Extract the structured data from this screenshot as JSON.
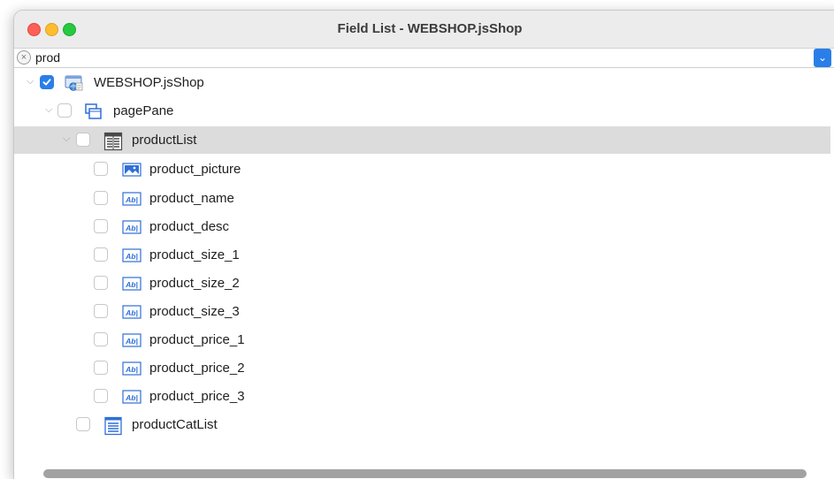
{
  "window": {
    "title": "Field List - WEBSHOP.jsShop"
  },
  "search": {
    "value": "prod",
    "clear_glyph": "×",
    "dropdown_glyph": "⌄"
  },
  "tree": {
    "root": {
      "label": "WEBSHOP.jsShop",
      "checked": true,
      "expanded": true,
      "icon": "form-icon"
    },
    "pagePane": {
      "label": "pagePane",
      "checked": false,
      "expanded": true,
      "icon": "page-pane-icon"
    },
    "productList": {
      "label": "productList",
      "checked": false,
      "expanded": true,
      "selected": true,
      "icon": "list-view-icon"
    },
    "fields": [
      {
        "label": "product_picture",
        "icon": "picture-field-icon"
      },
      {
        "label": "product_name",
        "icon": "text-field-icon"
      },
      {
        "label": "product_desc",
        "icon": "text-field-icon"
      },
      {
        "label": "product_size_1",
        "icon": "text-field-icon"
      },
      {
        "label": "product_size_2",
        "icon": "text-field-icon"
      },
      {
        "label": "product_size_3",
        "icon": "text-field-icon"
      },
      {
        "label": "product_price_1",
        "icon": "text-field-icon"
      },
      {
        "label": "product_price_2",
        "icon": "text-field-icon"
      },
      {
        "label": "product_price_3",
        "icon": "text-field-icon"
      }
    ],
    "productCatList": {
      "label": "productCatList",
      "checked": false,
      "icon": "list-icon"
    },
    "text_icon_glyph": "Ab|"
  },
  "colors": {
    "accent": "#2a7ee8",
    "selection": "#dcdcdc",
    "icon_blue": "#2e6fd8"
  }
}
